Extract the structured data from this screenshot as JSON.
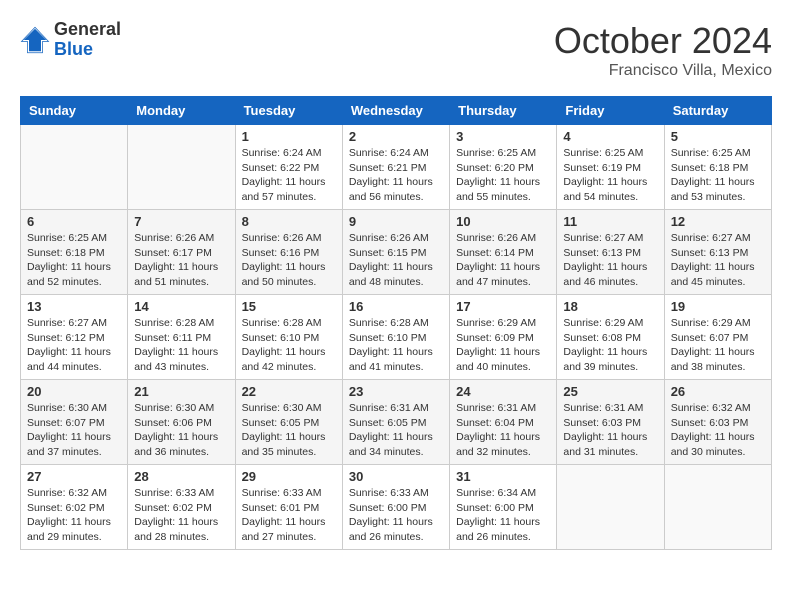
{
  "header": {
    "logo_general": "General",
    "logo_blue": "Blue",
    "month": "October 2024",
    "location": "Francisco Villa, Mexico"
  },
  "days_of_week": [
    "Sunday",
    "Monday",
    "Tuesday",
    "Wednesday",
    "Thursday",
    "Friday",
    "Saturday"
  ],
  "weeks": [
    [
      {
        "day": "",
        "info": ""
      },
      {
        "day": "",
        "info": ""
      },
      {
        "day": "1",
        "info": "Sunrise: 6:24 AM\nSunset: 6:22 PM\nDaylight: 11 hours and 57 minutes."
      },
      {
        "day": "2",
        "info": "Sunrise: 6:24 AM\nSunset: 6:21 PM\nDaylight: 11 hours and 56 minutes."
      },
      {
        "day": "3",
        "info": "Sunrise: 6:25 AM\nSunset: 6:20 PM\nDaylight: 11 hours and 55 minutes."
      },
      {
        "day": "4",
        "info": "Sunrise: 6:25 AM\nSunset: 6:19 PM\nDaylight: 11 hours and 54 minutes."
      },
      {
        "day": "5",
        "info": "Sunrise: 6:25 AM\nSunset: 6:18 PM\nDaylight: 11 hours and 53 minutes."
      }
    ],
    [
      {
        "day": "6",
        "info": "Sunrise: 6:25 AM\nSunset: 6:18 PM\nDaylight: 11 hours and 52 minutes."
      },
      {
        "day": "7",
        "info": "Sunrise: 6:26 AM\nSunset: 6:17 PM\nDaylight: 11 hours and 51 minutes."
      },
      {
        "day": "8",
        "info": "Sunrise: 6:26 AM\nSunset: 6:16 PM\nDaylight: 11 hours and 50 minutes."
      },
      {
        "day": "9",
        "info": "Sunrise: 6:26 AM\nSunset: 6:15 PM\nDaylight: 11 hours and 48 minutes."
      },
      {
        "day": "10",
        "info": "Sunrise: 6:26 AM\nSunset: 6:14 PM\nDaylight: 11 hours and 47 minutes."
      },
      {
        "day": "11",
        "info": "Sunrise: 6:27 AM\nSunset: 6:13 PM\nDaylight: 11 hours and 46 minutes."
      },
      {
        "day": "12",
        "info": "Sunrise: 6:27 AM\nSunset: 6:13 PM\nDaylight: 11 hours and 45 minutes."
      }
    ],
    [
      {
        "day": "13",
        "info": "Sunrise: 6:27 AM\nSunset: 6:12 PM\nDaylight: 11 hours and 44 minutes."
      },
      {
        "day": "14",
        "info": "Sunrise: 6:28 AM\nSunset: 6:11 PM\nDaylight: 11 hours and 43 minutes."
      },
      {
        "day": "15",
        "info": "Sunrise: 6:28 AM\nSunset: 6:10 PM\nDaylight: 11 hours and 42 minutes."
      },
      {
        "day": "16",
        "info": "Sunrise: 6:28 AM\nSunset: 6:10 PM\nDaylight: 11 hours and 41 minutes."
      },
      {
        "day": "17",
        "info": "Sunrise: 6:29 AM\nSunset: 6:09 PM\nDaylight: 11 hours and 40 minutes."
      },
      {
        "day": "18",
        "info": "Sunrise: 6:29 AM\nSunset: 6:08 PM\nDaylight: 11 hours and 39 minutes."
      },
      {
        "day": "19",
        "info": "Sunrise: 6:29 AM\nSunset: 6:07 PM\nDaylight: 11 hours and 38 minutes."
      }
    ],
    [
      {
        "day": "20",
        "info": "Sunrise: 6:30 AM\nSunset: 6:07 PM\nDaylight: 11 hours and 37 minutes."
      },
      {
        "day": "21",
        "info": "Sunrise: 6:30 AM\nSunset: 6:06 PM\nDaylight: 11 hours and 36 minutes."
      },
      {
        "day": "22",
        "info": "Sunrise: 6:30 AM\nSunset: 6:05 PM\nDaylight: 11 hours and 35 minutes."
      },
      {
        "day": "23",
        "info": "Sunrise: 6:31 AM\nSunset: 6:05 PM\nDaylight: 11 hours and 34 minutes."
      },
      {
        "day": "24",
        "info": "Sunrise: 6:31 AM\nSunset: 6:04 PM\nDaylight: 11 hours and 32 minutes."
      },
      {
        "day": "25",
        "info": "Sunrise: 6:31 AM\nSunset: 6:03 PM\nDaylight: 11 hours and 31 minutes."
      },
      {
        "day": "26",
        "info": "Sunrise: 6:32 AM\nSunset: 6:03 PM\nDaylight: 11 hours and 30 minutes."
      }
    ],
    [
      {
        "day": "27",
        "info": "Sunrise: 6:32 AM\nSunset: 6:02 PM\nDaylight: 11 hours and 29 minutes."
      },
      {
        "day": "28",
        "info": "Sunrise: 6:33 AM\nSunset: 6:02 PM\nDaylight: 11 hours and 28 minutes."
      },
      {
        "day": "29",
        "info": "Sunrise: 6:33 AM\nSunset: 6:01 PM\nDaylight: 11 hours and 27 minutes."
      },
      {
        "day": "30",
        "info": "Sunrise: 6:33 AM\nSunset: 6:00 PM\nDaylight: 11 hours and 26 minutes."
      },
      {
        "day": "31",
        "info": "Sunrise: 6:34 AM\nSunset: 6:00 PM\nDaylight: 11 hours and 26 minutes."
      },
      {
        "day": "",
        "info": ""
      },
      {
        "day": "",
        "info": ""
      }
    ]
  ]
}
